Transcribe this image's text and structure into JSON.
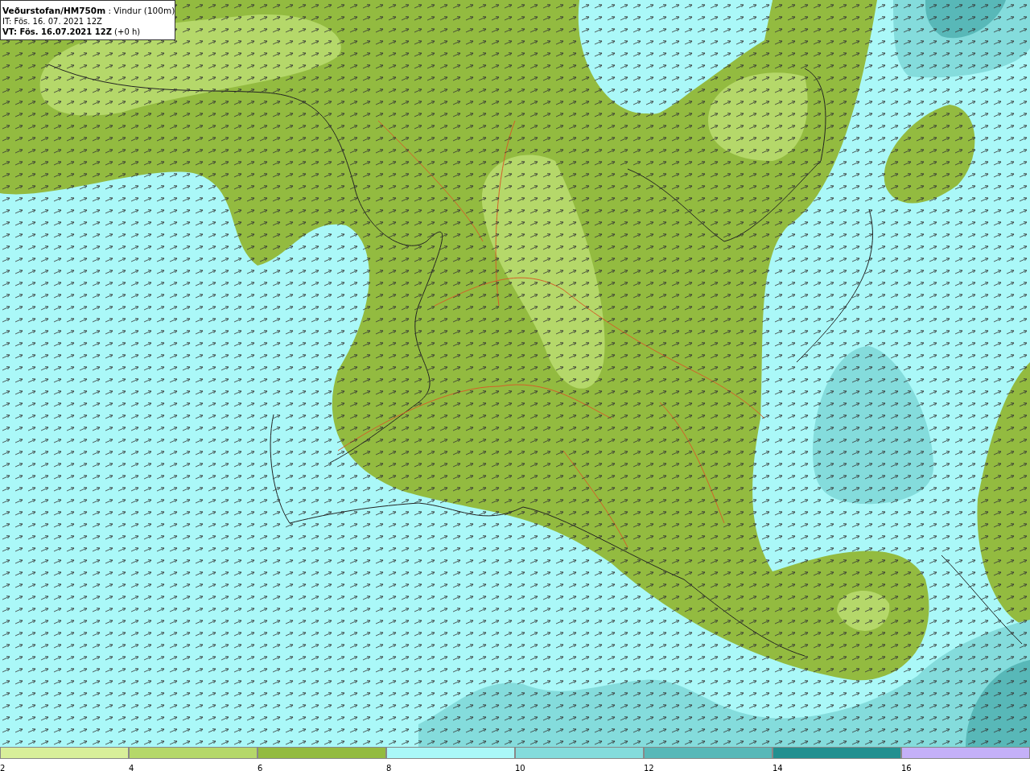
{
  "header": {
    "lines": [
      "**Veðurstofan/HM750m** : Vindur (100m)",
      "IT: Fös. 16. 07. 2021 12Z",
      "**VT: Fös. 16.07.2021 12Z** (+0 h)"
    ]
  },
  "legend": {
    "bins": [
      {
        "label": "2",
        "color": "#d8ef9a"
      },
      {
        "label": "4",
        "color": "#b5d86a"
      },
      {
        "label": "6",
        "color": "#93bb40"
      },
      {
        "label": "8",
        "color": "#aaf8f8"
      },
      {
        "label": "10",
        "color": "#84dcdc"
      },
      {
        "label": "12",
        "color": "#58b8b8"
      },
      {
        "label": "14",
        "color": "#229090"
      },
      {
        "label": "16",
        "color": "#c4b0f8"
      }
    ]
  }
}
